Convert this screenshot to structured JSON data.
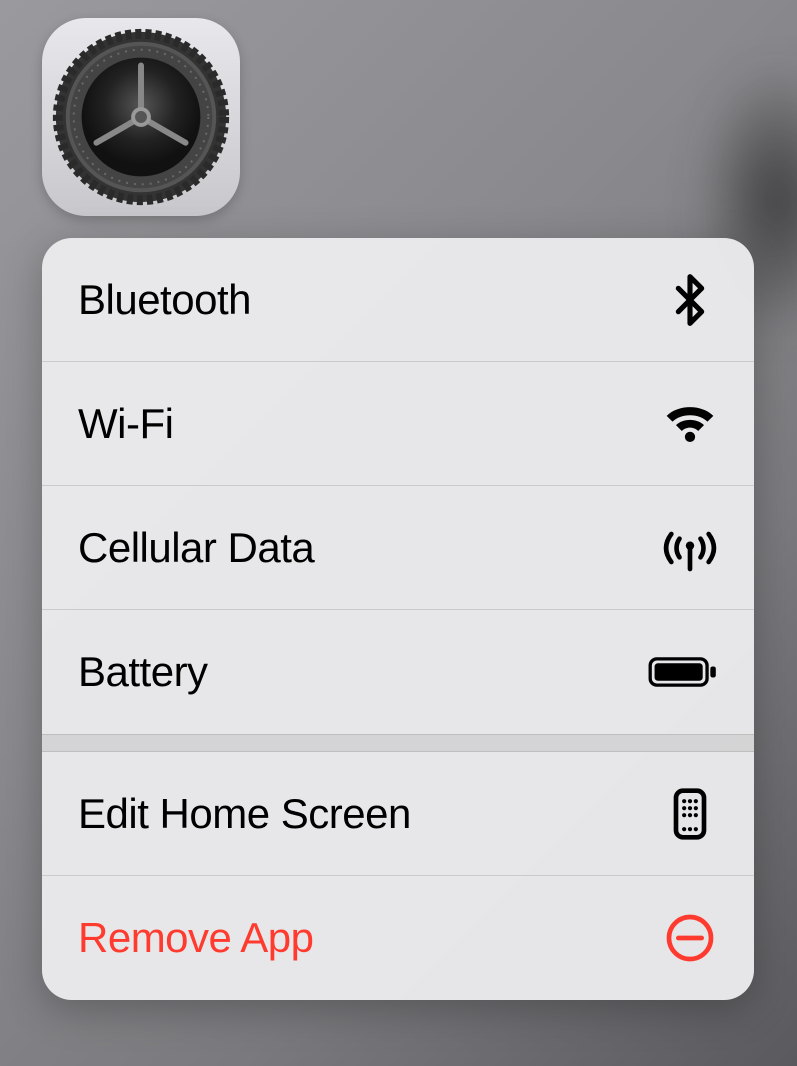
{
  "app_icon_name": "Settings",
  "menu": {
    "groups": [
      {
        "items": [
          {
            "id": "bluetooth",
            "label": "Bluetooth",
            "icon": "bluetooth-icon",
            "destructive": false
          },
          {
            "id": "wifi",
            "label": "Wi-Fi",
            "icon": "wifi-icon",
            "destructive": false
          },
          {
            "id": "cellular",
            "label": "Cellular Data",
            "icon": "cellular-icon",
            "destructive": false
          },
          {
            "id": "battery",
            "label": "Battery",
            "icon": "battery-icon",
            "destructive": false
          }
        ]
      },
      {
        "items": [
          {
            "id": "edit-home",
            "label": "Edit Home Screen",
            "icon": "home-screen-icon",
            "destructive": false
          },
          {
            "id": "remove-app",
            "label": "Remove App",
            "icon": "remove-icon",
            "destructive": true
          }
        ]
      }
    ]
  },
  "colors": {
    "destructive": "#ff3b30",
    "text": "#000000",
    "menu_bg": "rgba(235,235,237,0.96)"
  }
}
